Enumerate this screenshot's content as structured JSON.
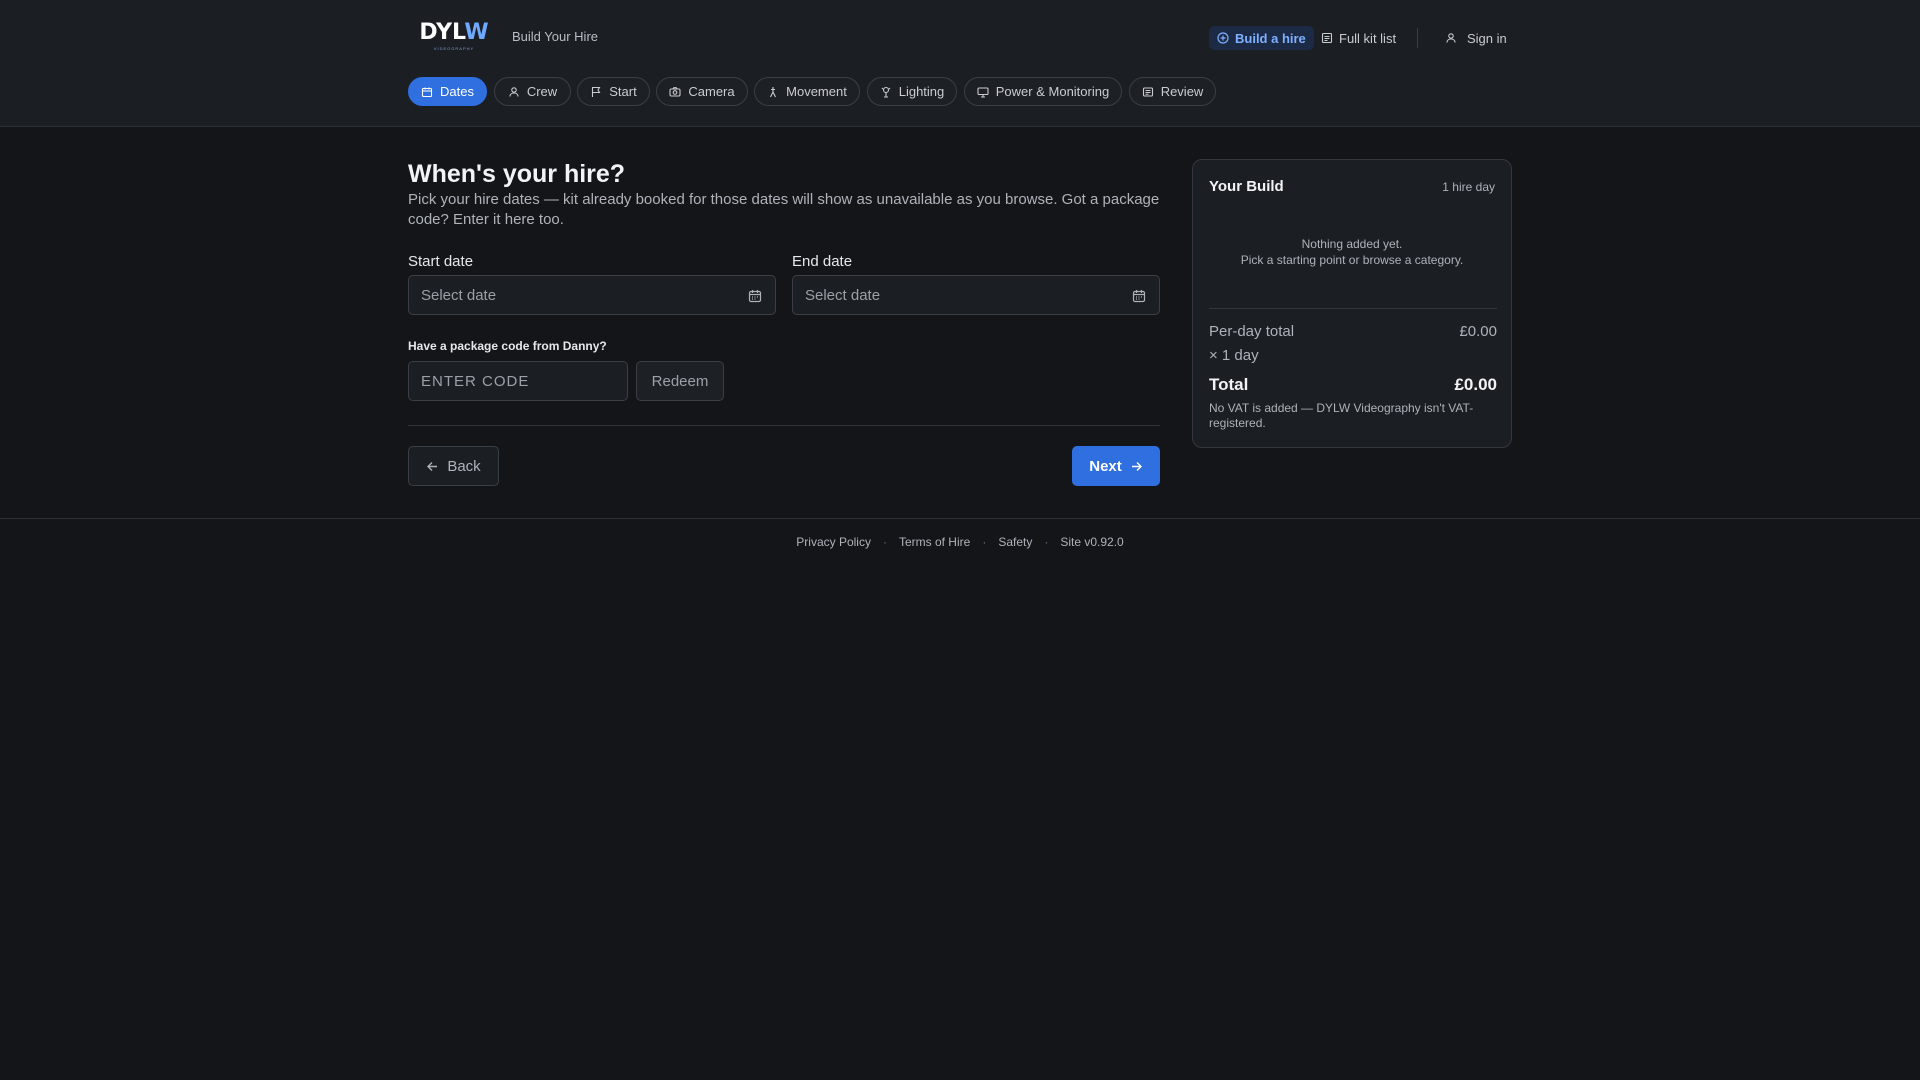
{
  "header": {
    "logo_text_a": "DYL",
    "logo_text_b": "W",
    "logo_sub": "VIDEOGRAPHY",
    "brand_title": "Build Your Hire",
    "nav": [
      {
        "label": "Build a hire",
        "icon": "plus-circle-icon",
        "active": true
      },
      {
        "label": "Full kit list",
        "icon": "list-icon",
        "active": false
      },
      {
        "label": "Sign in",
        "icon": "user-icon",
        "active": false
      }
    ]
  },
  "steps": [
    {
      "label": "Dates",
      "icon": "calendar-icon",
      "active": true
    },
    {
      "label": "Crew",
      "icon": "user-icon"
    },
    {
      "label": "Start",
      "icon": "flag-icon"
    },
    {
      "label": "Camera",
      "icon": "camera-icon"
    },
    {
      "label": "Movement",
      "icon": "movement-icon"
    },
    {
      "label": "Lighting",
      "icon": "lamp-icon"
    },
    {
      "label": "Power & Monitoring",
      "icon": "monitor-icon"
    },
    {
      "label": "Review",
      "icon": "list-icon"
    }
  ],
  "main": {
    "heading": "When's your hire?",
    "intro": "Pick your hire dates — kit already booked for those dates will show as unavailable as you browse. Got a package code? Enter it here too.",
    "start_label": "Start date",
    "start_placeholder": "Select date",
    "end_label": "End date",
    "end_placeholder": "Select date",
    "code_label": "Have a package code from Danny?",
    "code_placeholder": "ENTER CODE",
    "redeem_label": "Redeem",
    "back_label": "Back",
    "next_label": "Next"
  },
  "summary": {
    "title": "Your Build",
    "days": "1 hire day",
    "empty_line1": "Nothing added yet.",
    "empty_line2": "Pick a starting point or browse a category.",
    "per_day_label": "Per-day total",
    "per_day_value": "£0.00",
    "multiplier": "× 1 day",
    "total_label": "Total",
    "total_value": "£0.00",
    "vat_note": "No VAT is added — DYLW Videography isn't VAT-registered."
  },
  "footer": {
    "links": [
      "Privacy Policy",
      "Terms of Hire",
      "Safety"
    ],
    "version": "Site v0.92.0"
  },
  "colors": {
    "accent": "#2f6fe0",
    "background": "#131519",
    "panel": "#1b1e23"
  }
}
